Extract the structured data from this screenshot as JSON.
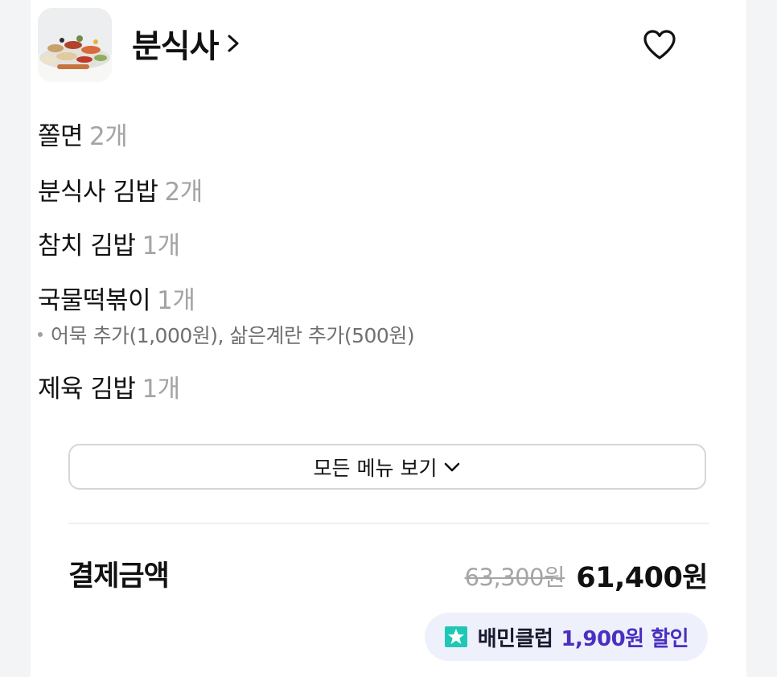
{
  "store": {
    "name": "분식사",
    "thumbnail_icon": "food-spread-photo",
    "favorite_icon": "heart-outline-icon",
    "chevron_icon": "chevron-right-icon"
  },
  "menu_items": [
    {
      "name": "쫄면",
      "qty": "2개"
    },
    {
      "name": "분식사 김밥",
      "qty": "2개"
    },
    {
      "name": "참치 김밥",
      "qty": "1개"
    },
    {
      "name": "국물떡볶이",
      "qty": "1개",
      "options": "어묵 추가(1,000원), 삶은계란 추가(500원)"
    },
    {
      "name": "제육 김밥",
      "qty": "1개"
    }
  ],
  "all_menu_button": {
    "label": "모든 메뉴 보기",
    "icon": "chevron-down-icon"
  },
  "payment": {
    "label": "결제금액",
    "original_price": "63,300원",
    "final_price": "61,400원"
  },
  "club_badge": {
    "name": "배민클럽",
    "discount": "1,900원 할인",
    "icon": "club-star-icon",
    "colors": {
      "icon": "#1ec8b4",
      "discount_text": "#4a2fc1",
      "background": "#eef0fc"
    }
  }
}
